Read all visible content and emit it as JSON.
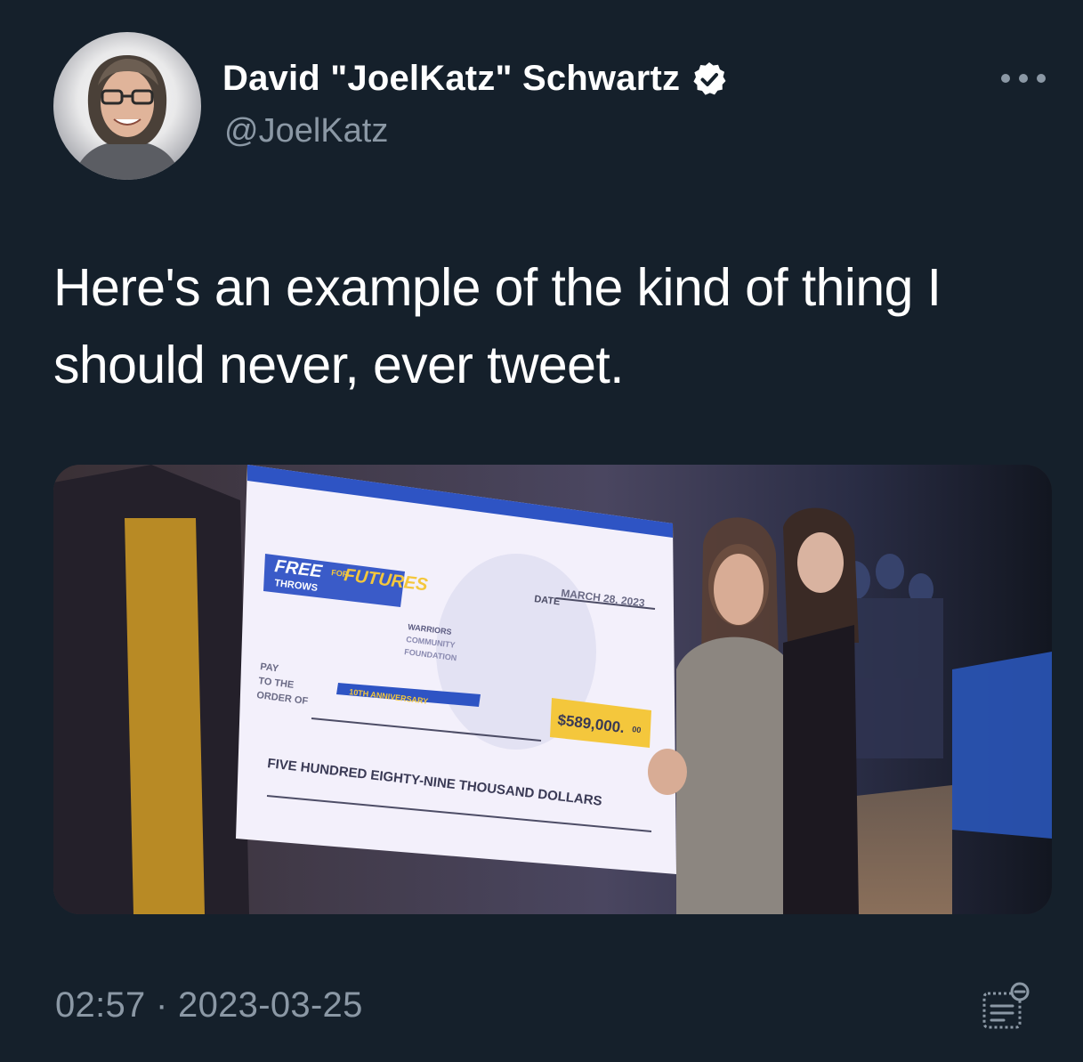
{
  "author": {
    "display_name": "David \"JoelKatz\" Schwartz",
    "handle": "@JoelKatz",
    "verified": true,
    "avatar_icon": "profile-photo"
  },
  "tweet": {
    "text": "Here's an example of the kind of thing I should never, ever tweet.",
    "timestamp": "02:57 · 2023-03-25"
  },
  "media": {
    "check": {
      "logo_line1": "FREE",
      "logo_line2": "THROWS",
      "logo_line3": "FOR",
      "logo_line4": "FUTURES",
      "date_label": "DATE",
      "date_value": "MARCH 28, 2023",
      "org_line1": "WARRIORS",
      "org_line2": "COMMUNITY",
      "org_line3": "FOUNDATION",
      "anniversary": "10TH ANNIVERSARY",
      "pay_line1": "PAY",
      "pay_line2": "TO THE",
      "pay_line3": "ORDER OF",
      "amount": "$589,000.",
      "amount_cents": "00",
      "written_amount": "FIVE HUNDRED EIGHTY-NINE THOUSAND DOLLARS"
    }
  },
  "icons": {
    "more": "more-horizontal-icon",
    "verified": "verified-badge-icon",
    "analytics": "analytics-icon"
  },
  "colors": {
    "background": "#15202b",
    "secondary_text": "#8b98a5",
    "primary_text": "#ffffff"
  }
}
